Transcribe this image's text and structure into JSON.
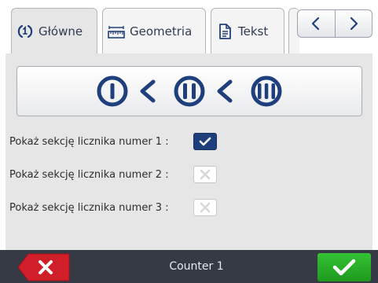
{
  "tabs": [
    {
      "label": "Główne",
      "icon": "counter-order-icon",
      "active": true
    },
    {
      "label": "Geometria",
      "icon": "ruler-icon",
      "active": false
    },
    {
      "label": "Tekst",
      "icon": "document-icon",
      "active": false
    }
  ],
  "nav": {
    "prev_icon": "chevron-left-icon",
    "next_icon": "chevron-right-icon"
  },
  "order_button": {
    "icons": [
      "section-1-icon",
      "less-than-icon",
      "section-2-icon",
      "less-than-icon",
      "section-3-icon"
    ]
  },
  "sections": [
    {
      "label": "Pokaż sekcję licznika numer 1 :",
      "checked": true
    },
    {
      "label": "Pokaż sekcję licznika numer 2 :",
      "checked": false
    },
    {
      "label": "Pokaż sekcję licznika numer 3 :",
      "checked": false
    }
  ],
  "bottom": {
    "title": "Counter 1",
    "cancel_icon": "close-icon",
    "ok_icon": "check-icon"
  },
  "colors": {
    "accent": "#1f3f7c",
    "ok": "#2db52d",
    "cancel": "#d01f2a",
    "bar": "#353a45",
    "panel": "#e6e6e6"
  }
}
